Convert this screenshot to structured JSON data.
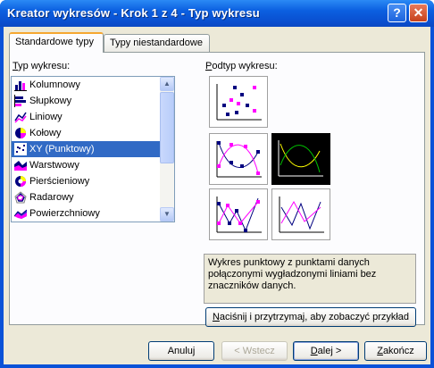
{
  "window": {
    "title": "Kreator wykresów - Krok 1 z 4 - Typ wykresu",
    "help_label": "?",
    "close_label": "✕"
  },
  "tabs": [
    {
      "label": "Standardowe typy"
    },
    {
      "label": "Typy niestandardowe"
    }
  ],
  "chart_type_label": {
    "underlined": "T",
    "rest": "yp wykresu:"
  },
  "chart_types": [
    {
      "label": "Kolumnowy",
      "icon": "column-chart-icon"
    },
    {
      "label": "Słupkowy",
      "icon": "bar-chart-icon"
    },
    {
      "label": "Liniowy",
      "icon": "line-chart-icon"
    },
    {
      "label": "Kołowy",
      "icon": "pie-chart-icon"
    },
    {
      "label": "XY (Punktowy)",
      "icon": "scatter-chart-icon",
      "selected": true
    },
    {
      "label": "Warstwowy",
      "icon": "area-chart-icon"
    },
    {
      "label": "Pierścieniowy",
      "icon": "doughnut-chart-icon"
    },
    {
      "label": "Radarowy",
      "icon": "radar-chart-icon"
    },
    {
      "label": "Powierzchniowy",
      "icon": "surface-chart-icon"
    }
  ],
  "subtype_label": {
    "underlined": "P",
    "rest": "odtyp wykresu:"
  },
  "subtypes": [
    {
      "name": "scatter-markers-only"
    },
    {
      "name": "scatter-smooth-with-markers"
    },
    {
      "name": "scatter-smooth-no-markers",
      "selected": true
    },
    {
      "name": "scatter-straight-with-markers"
    },
    {
      "name": "scatter-straight-no-markers"
    }
  ],
  "description": "Wykres punktowy z punktami danych połączonymi wygładzonymi liniami bez znaczników danych.",
  "preview_button": {
    "underlined": "N",
    "rest": "aciśnij i przytrzymaj, aby zobaczyć przykład"
  },
  "buttons": {
    "cancel": "Anuluj",
    "back": "< Wstecz",
    "next": {
      "underlined": "D",
      "rest": "alej >"
    },
    "finish": {
      "underlined": "Z",
      "rest": "akończ"
    }
  },
  "colors": {
    "accent_selection": "#316ac5",
    "series_magenta": "#ff00ff",
    "series_navy": "#000080",
    "series_yellow": "#ffff00",
    "series_green": "#00c000"
  }
}
